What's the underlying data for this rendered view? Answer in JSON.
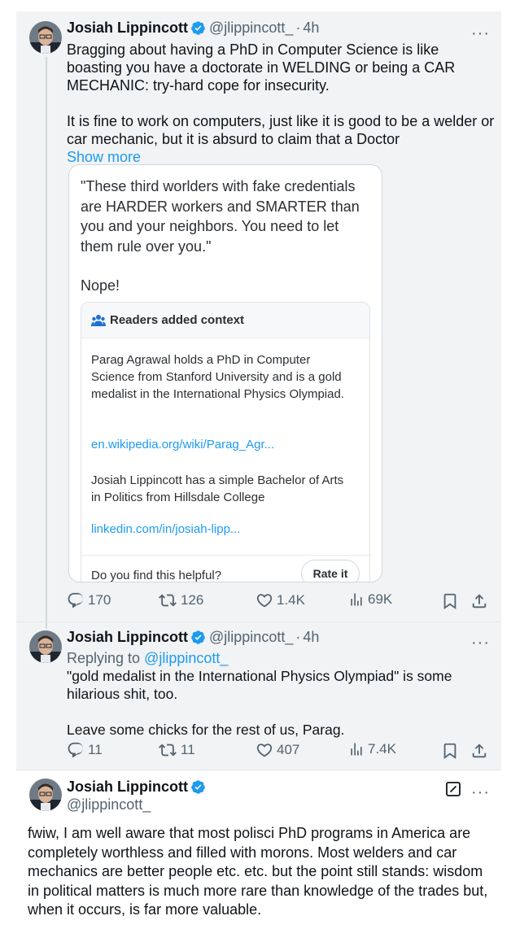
{
  "thread": {
    "tweet1": {
      "author": {
        "name": "Josiah Lippincott",
        "handle": "@jlippincott_",
        "time": "4h"
      },
      "text": [
        "Bragging about having a PhD in Computer Science is like boasting you have a doctorate in WELDING or being a CAR MECHANIC: try-hard cope for insecurity.",
        "It is fine to work on computers, just like it is good to be a welder or car mechanic, but it is absurd to claim that a Doctor"
      ],
      "show_more": "Show more",
      "quote": {
        "text": [
          "\"These third worlders with fake credentials are HARDER workers and SMARTER than you and your neighbors. You need to let them rule over you.\"",
          "Nope!"
        ],
        "community_notes": {
          "title": "Readers added context",
          "note1": "Parag Agrawal holds a PhD in Computer Science from Stanford University and is a gold medalist in the International Physics Olympiad.",
          "link1": "en.wikipedia.org/wiki/Parag_Agr...",
          "note2": "Josiah Lippincott has a simple Bachelor of Arts in Politics from Hillsdale College",
          "link2": "linkedin.com/in/josiah-lipp...",
          "helpful_prompt": "Do you find this helpful?",
          "rate_label": "Rate it"
        }
      },
      "stats": {
        "replies": "170",
        "reposts": "126",
        "likes": "1.4K",
        "views": "69K"
      }
    },
    "tweet2": {
      "author": {
        "name": "Josiah Lippincott",
        "handle": "@jlippincott_",
        "time": "4h"
      },
      "replying_prefix": "Replying to",
      "replying_handle": "@jlippincott_",
      "text": [
        "\"gold medalist in the International Physics Olympiad\" is some hilarious shit, too.",
        "Leave some chicks for the rest of us, Parag."
      ],
      "stats": {
        "replies": "11",
        "reposts": "11",
        "likes": "407",
        "views": "7.4K"
      }
    },
    "tweet3": {
      "author": {
        "name": "Josiah Lippincott",
        "handle": "@jlippincott_"
      },
      "text": "fwiw, I am well aware that most polisci PhD programs in America are completely worthless and filled with morons. Most welders and car mechanics are better people etc. etc. but the point still stands: wisdom in political matters is much more rare than knowledge of the trades but, when it occurs, is far more valuable."
    }
  },
  "icons": {
    "verified": "verified-badge-icon",
    "more": "more-options-icon",
    "reply": "reply-icon",
    "repost": "repost-icon",
    "like": "like-icon",
    "views": "views-icon",
    "bookmark": "bookmark-icon",
    "share": "share-icon",
    "edit": "edited-icon",
    "notes": "community-notes-icon"
  },
  "colors": {
    "accent": "#1d9bf0",
    "verified": "#1d9bf0",
    "secondary_text": "#536471",
    "thread_bg": "#f2f3f4"
  }
}
